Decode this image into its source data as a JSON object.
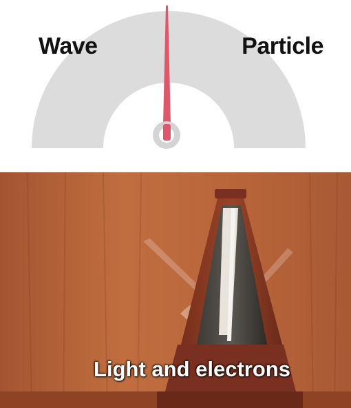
{
  "meme": {
    "dial": {
      "left_label": "Wave",
      "right_label": "Particle",
      "needle_position": 0.5,
      "needle_color": "#e0566b",
      "arc_color": "#dcdcdc"
    },
    "photo": {
      "subject": "metronome-icon",
      "caption": "Light and electrons",
      "wood_color": "#b8643a",
      "metronome_color": "#8a3a24"
    }
  }
}
